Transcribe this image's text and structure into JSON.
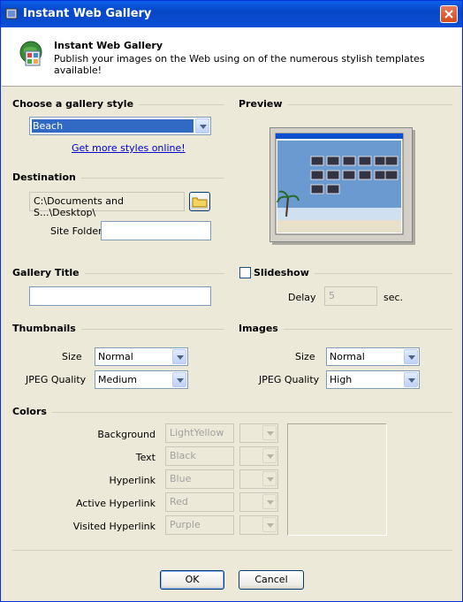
{
  "window": {
    "title": "Instant Web Gallery"
  },
  "header": {
    "title": "Instant Web Gallery",
    "subtitle": "Publish your images on the Web using on of the numerous stylish templates available!"
  },
  "gallery_style": {
    "heading": "Choose a gallery style",
    "value": "Beach",
    "link": "Get more styles online!"
  },
  "preview": {
    "heading": "Preview"
  },
  "destination": {
    "heading": "Destination",
    "path": "C:\\Documents and S...\\Desktop\\",
    "site_folder_label": "Site Folder",
    "site_folder_value": ""
  },
  "gallery_title": {
    "heading": "Gallery Title",
    "value": ""
  },
  "slideshow": {
    "label": "Slideshow",
    "checked": false,
    "delay_label": "Delay",
    "delay_value": "5",
    "delay_unit": "sec."
  },
  "thumbnails": {
    "heading": "Thumbnails",
    "size_label": "Size",
    "size_value": "Normal",
    "quality_label": "JPEG Quality",
    "quality_value": "Medium"
  },
  "images": {
    "heading": "Images",
    "size_label": "Size",
    "size_value": "Normal",
    "quality_label": "JPEG Quality",
    "quality_value": "High"
  },
  "colors": {
    "heading": "Colors",
    "rows": [
      {
        "label": "Background",
        "value": "LightYellow"
      },
      {
        "label": "Text",
        "value": "Black"
      },
      {
        "label": "Hyperlink",
        "value": "Blue"
      },
      {
        "label": "Active Hyperlink",
        "value": "Red"
      },
      {
        "label": "Visited Hyperlink",
        "value": "Purple"
      }
    ]
  },
  "buttons": {
    "ok": "OK",
    "cancel": "Cancel"
  },
  "theme": {
    "titlebar": "#0747c4",
    "selection": "#316ac5",
    "link": "#0000cc"
  }
}
